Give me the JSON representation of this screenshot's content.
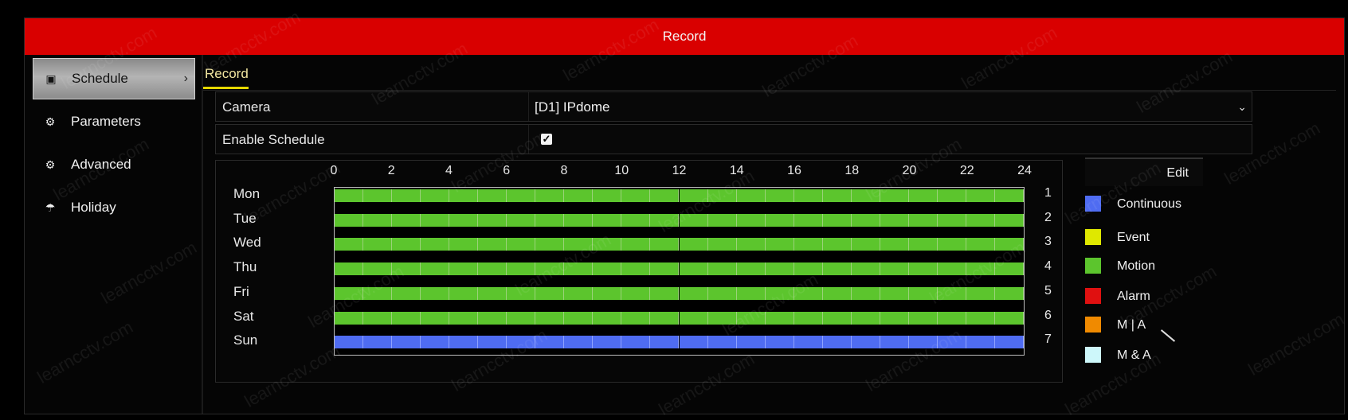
{
  "window": {
    "title": "Record"
  },
  "sidebar": {
    "items": [
      {
        "label": "Schedule",
        "icon": "calendar-icon",
        "active": true
      },
      {
        "label": "Parameters",
        "icon": "gear-icon",
        "active": false
      },
      {
        "label": "Advanced",
        "icon": "gear-advanced-icon",
        "active": false
      },
      {
        "label": "Holiday",
        "icon": "umbrella-icon",
        "active": false
      }
    ]
  },
  "tab": {
    "label": "Record"
  },
  "form": {
    "camera_label": "Camera",
    "camera_value": "[D1] IPdome",
    "enable_label": "Enable Schedule",
    "enable_checked": true
  },
  "schedule": {
    "hours": [
      "0",
      "2",
      "4",
      "6",
      "8",
      "10",
      "12",
      "14",
      "16",
      "18",
      "20",
      "22",
      "24"
    ],
    "days": [
      {
        "name": "Mon",
        "num": "1",
        "type": "Motion"
      },
      {
        "name": "Tue",
        "num": "2",
        "type": "Motion"
      },
      {
        "name": "Wed",
        "num": "3",
        "type": "Motion"
      },
      {
        "name": "Thu",
        "num": "4",
        "type": "Motion"
      },
      {
        "name": "Fri",
        "num": "5",
        "type": "Motion"
      },
      {
        "name": "Sat",
        "num": "6",
        "type": "Motion"
      },
      {
        "name": "Sun",
        "num": "7",
        "type": "Continuous"
      }
    ]
  },
  "legend": {
    "edit_label": "Edit",
    "items": [
      {
        "label": "Continuous",
        "color": "#4f6cf2"
      },
      {
        "label": "Event",
        "color": "#dfe800"
      },
      {
        "label": "Motion",
        "color": "#5cc52d"
      },
      {
        "label": "Alarm",
        "color": "#e01010"
      },
      {
        "label": "M | A",
        "color": "#f08a00"
      },
      {
        "label": "M & A",
        "color": "#cdf7fa"
      }
    ]
  },
  "watermark": "learncctv.com"
}
